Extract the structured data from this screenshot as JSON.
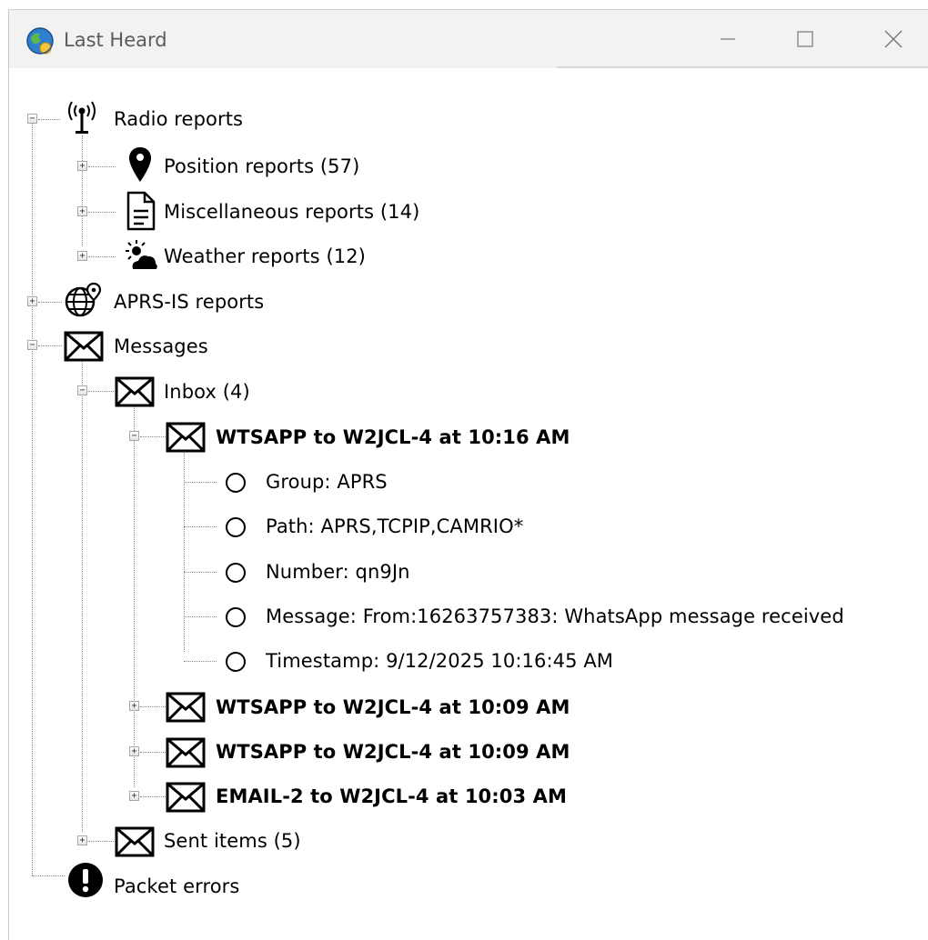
{
  "window": {
    "title": "Last Heard",
    "icons": {
      "app": "globe-app-icon",
      "minimize": "minimize-icon",
      "maximize": "maximize-icon",
      "close": "close-icon"
    }
  },
  "tree": {
    "radio_reports": {
      "label": "Radio reports",
      "icon": "antenna-icon",
      "expanded": true,
      "children": {
        "position": {
          "label": "Position reports (57)",
          "icon": "map-pin-icon",
          "expanded": false
        },
        "misc": {
          "label": "Miscellaneous reports (14)",
          "icon": "document-icon",
          "expanded": false
        },
        "weather": {
          "label": "Weather reports (12)",
          "icon": "weather-icon",
          "expanded": false
        }
      }
    },
    "aprs_is": {
      "label": "APRS-IS reports",
      "icon": "globe-pin-icon",
      "expanded": false
    },
    "messages": {
      "label": "Messages",
      "icon": "envelope-icon",
      "expanded": true,
      "inbox": {
        "label": "Inbox (4)",
        "expanded": true,
        "items": [
          {
            "label": "WTSAPP to W2JCL-4 at 10:16 AM",
            "expanded": true,
            "details": [
              "Group: APRS",
              "Path: APRS,TCPIP,CAMRIO*",
              "Number: qn9Jn",
              "Message: From:16263757383: WhatsApp message received",
              "Timestamp: 9/12/2025 10:16:45 AM"
            ]
          },
          {
            "label": "WTSAPP to W2JCL-4 at 10:09 AM",
            "expanded": false
          },
          {
            "label": "WTSAPP to W2JCL-4 at 10:09 AM",
            "expanded": false
          },
          {
            "label": "EMAIL-2 to W2JCL-4 at 10:03 AM",
            "expanded": false
          }
        ]
      },
      "sent": {
        "label": "Sent items (5)",
        "expanded": false
      }
    },
    "packet_errors": {
      "label": "Packet errors",
      "icon": "exclamation-icon"
    }
  }
}
